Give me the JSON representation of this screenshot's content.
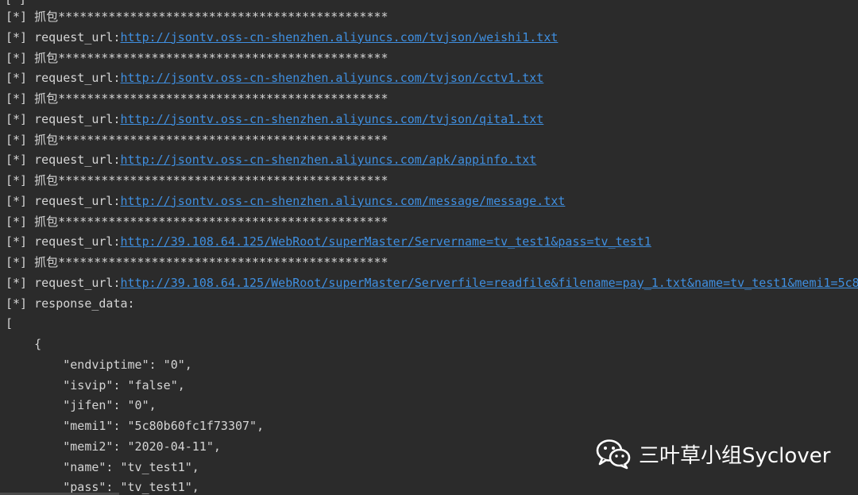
{
  "top_line": "[*]",
  "log_lines": [
    {
      "prefix": "[*] ",
      "text": "抓包**********************************************"
    },
    {
      "prefix": "[*] ",
      "text": "request_url:",
      "url": "http://jsontv.oss-cn-shenzhen.aliyuncs.com/tvjson/weishi1.txt"
    },
    {
      "prefix": "[*] ",
      "text": "抓包**********************************************"
    },
    {
      "prefix": "[*] ",
      "text": "request_url:",
      "url": "http://jsontv.oss-cn-shenzhen.aliyuncs.com/tvjson/cctv1.txt"
    },
    {
      "prefix": "[*] ",
      "text": "抓包**********************************************"
    },
    {
      "prefix": "[*] ",
      "text": "request_url:",
      "url": "http://jsontv.oss-cn-shenzhen.aliyuncs.com/tvjson/qita1.txt"
    },
    {
      "prefix": "[*] ",
      "text": "抓包**********************************************"
    },
    {
      "prefix": "[*] ",
      "text": "request_url:",
      "url": "http://jsontv.oss-cn-shenzhen.aliyuncs.com/apk/appinfo.txt"
    },
    {
      "prefix": "[*] ",
      "text": "抓包**********************************************"
    },
    {
      "prefix": "[*] ",
      "text": "request_url:",
      "url": "http://jsontv.oss-cn-shenzhen.aliyuncs.com/message/message.txt"
    },
    {
      "prefix": "[*] ",
      "text": "抓包**********************************************"
    },
    {
      "prefix": "[*] ",
      "text": "request_url:",
      "url": "http://39.108.64.125/WebRoot/superMaster/Servername=tv_test1&pass=tv_test1"
    },
    {
      "prefix": "[*] ",
      "text": "抓包**********************************************"
    },
    {
      "prefix": "[*] ",
      "text": "request_url:",
      "url": "http://39.108.64.125/WebRoot/superMaster/Serverfile=readfile&filename=pay_1.txt&name=tv_test1&memi1=5c8"
    },
    {
      "prefix": "[*] ",
      "text": "response_data:"
    },
    {
      "prefix": "",
      "text": "["
    },
    {
      "prefix": "",
      "text": "    {"
    },
    {
      "prefix": "",
      "text": "        \"endviptime\": \"0\","
    },
    {
      "prefix": "",
      "text": "        \"isvip\": \"false\","
    },
    {
      "prefix": "",
      "text": "        \"jifen\": \"0\","
    },
    {
      "prefix": "",
      "text": "        \"memi1\": \"5c80b60fc1f73307\","
    },
    {
      "prefix": "",
      "text": "        \"memi2\": \"2020-04-11\","
    },
    {
      "prefix": "",
      "text": "        \"name\": \"tv_test1\","
    },
    {
      "prefix": "",
      "text": "        \"pass\": \"tv_test1\","
    }
  ],
  "watermark": {
    "text": "三叶草小组Syclover",
    "icon": "wechat-icon"
  },
  "colors": {
    "background": "#2b2b2b",
    "text": "#d4d4d4",
    "link": "#3f8fe0",
    "watermark": "#ffffff"
  }
}
